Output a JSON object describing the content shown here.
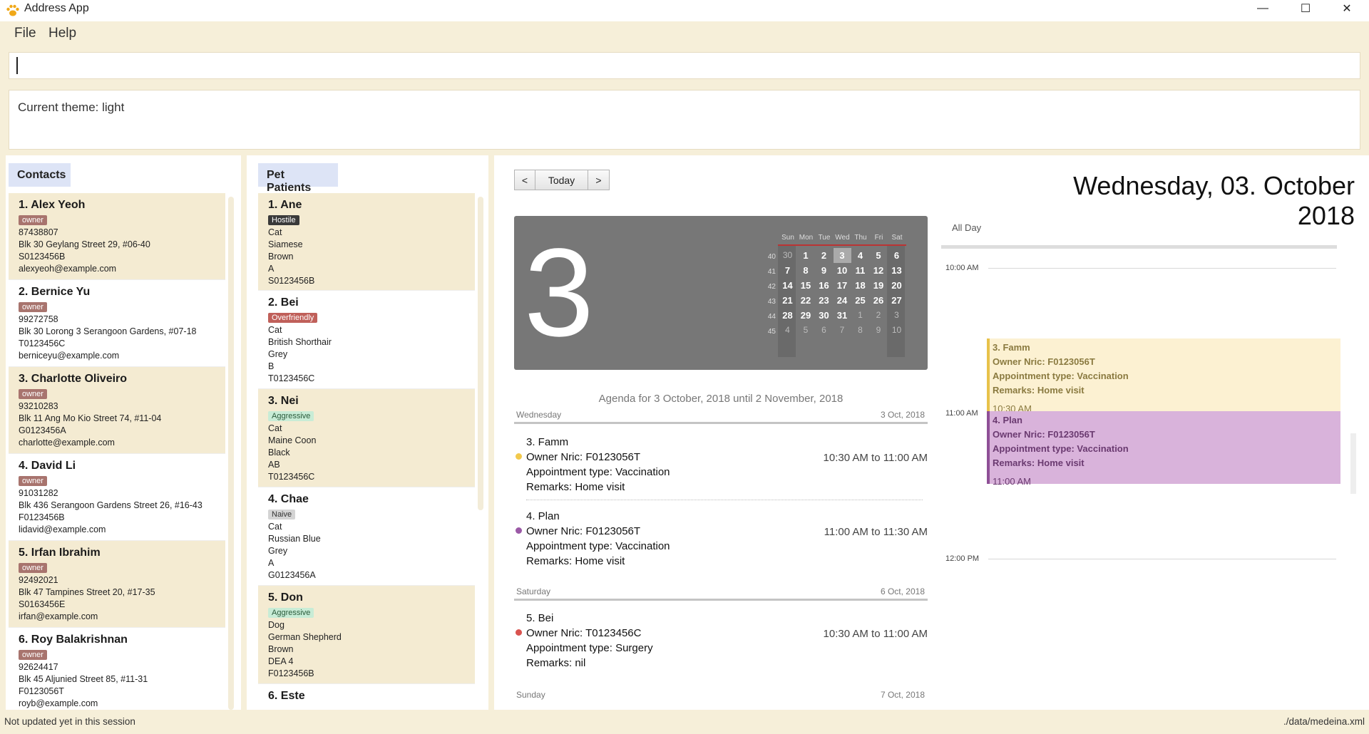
{
  "window": {
    "title": "Address App",
    "minimize": "—",
    "maximize": "☐",
    "close": "✕"
  },
  "menu": {
    "file": "File",
    "help": "Help"
  },
  "command": {
    "value": ""
  },
  "result": {
    "text": "Current theme: light"
  },
  "contacts": {
    "header": "Contacts",
    "items": [
      {
        "index": "1.",
        "name": "Alex Yeoh",
        "tag": "owner",
        "phone": "87438807",
        "address": "Blk 30 Geylang Street 29, #06-40",
        "nric": "S0123456B",
        "email": "alexyeoh@example.com"
      },
      {
        "index": "2.",
        "name": "Bernice Yu",
        "tag": "owner",
        "phone": "99272758",
        "address": "Blk 30 Lorong 3 Serangoon Gardens, #07-18",
        "nric": "T0123456C",
        "email": "berniceyu@example.com"
      },
      {
        "index": "3.",
        "name": "Charlotte Oliveiro",
        "tag": "owner",
        "phone": "93210283",
        "address": "Blk 11 Ang Mo Kio Street 74, #11-04",
        "nric": "G0123456A",
        "email": "charlotte@example.com"
      },
      {
        "index": "4.",
        "name": "David Li",
        "tag": "owner",
        "phone": "91031282",
        "address": "Blk 436 Serangoon Gardens Street 26, #16-43",
        "nric": "F0123456B",
        "email": "lidavid@example.com"
      },
      {
        "index": "5.",
        "name": "Irfan Ibrahim",
        "tag": "owner",
        "phone": "92492021",
        "address": "Blk 47 Tampines Street 20, #17-35",
        "nric": "S0163456E",
        "email": "irfan@example.com"
      },
      {
        "index": "6.",
        "name": "Roy Balakrishnan",
        "tag": "owner",
        "phone": "92624417",
        "address": "Blk 45 Aljunied Street 85, #11-31",
        "nric": "F0123056T",
        "email": "royb@example.com"
      }
    ]
  },
  "pets": {
    "header": "Pet Patients",
    "items": [
      {
        "index": "1.",
        "name": "Ane",
        "tag": "Hostile",
        "tag_color": "#3a3a3a",
        "tag_text": "#ffffff",
        "species": "Cat",
        "breed": "Siamese",
        "colour": "Brown",
        "blood": "A",
        "owner": "S0123456B"
      },
      {
        "index": "2.",
        "name": "Bei",
        "tag": "Overfriendly",
        "tag_color": "#c0605a",
        "tag_text": "#ffffff",
        "species": "Cat",
        "breed": "British Shorthair",
        "colour": "Grey",
        "blood": "B",
        "owner": "T0123456C"
      },
      {
        "index": "3.",
        "name": "Nei",
        "tag": "Aggressive",
        "tag_color": "#c8ecd6",
        "tag_text": "#2a5a3a",
        "species": "Cat",
        "breed": "Maine Coon",
        "colour": "Black",
        "blood": "AB",
        "owner": "T0123456C"
      },
      {
        "index": "4.",
        "name": "Chae",
        "tag": "Naive",
        "tag_color": "#d4d4d4",
        "tag_text": "#333333",
        "species": "Cat",
        "breed": "Russian Blue",
        "colour": "Grey",
        "blood": "A",
        "owner": "G0123456A"
      },
      {
        "index": "5.",
        "name": "Don",
        "tag": "Aggressive",
        "tag_color": "#c8ecd6",
        "tag_text": "#2a5a3a",
        "species": "Dog",
        "breed": "German Shepherd",
        "colour": "Brown",
        "blood": "DEA 4",
        "owner": "F0123456B"
      },
      {
        "index": "6.",
        "name": "Este",
        "tag": "",
        "tag_color": "",
        "tag_text": "",
        "species": "",
        "breed": "",
        "colour": "",
        "blood": "",
        "owner": ""
      }
    ]
  },
  "calendar": {
    "prev": "<",
    "today": "Today",
    "next": ">",
    "date_heading": "Wednesday, 03. October 2018",
    "big_day": "3",
    "weekdays": [
      "Sun",
      "Mon",
      "Tue",
      "Wed",
      "Thu",
      "Fri",
      "Sat"
    ],
    "weeks": [
      {
        "wk": "40",
        "days": [
          "30",
          "1",
          "2",
          "3",
          "4",
          "5",
          "6"
        ]
      },
      {
        "wk": "41",
        "days": [
          "7",
          "8",
          "9",
          "10",
          "11",
          "12",
          "13"
        ]
      },
      {
        "wk": "42",
        "days": [
          "14",
          "15",
          "16",
          "17",
          "18",
          "19",
          "20"
        ]
      },
      {
        "wk": "43",
        "days": [
          "21",
          "22",
          "23",
          "24",
          "25",
          "26",
          "27"
        ]
      },
      {
        "wk": "44",
        "days": [
          "28",
          "29",
          "30",
          "31",
          "1",
          "2",
          "3"
        ]
      },
      {
        "wk": "45",
        "days": [
          "4",
          "5",
          "6",
          "7",
          "8",
          "9",
          "10"
        ]
      }
    ],
    "agenda_title": "Agenda for 3 October, 2018 until 2 November, 2018",
    "day_heads": [
      {
        "name": "Wednesday",
        "date": "3 Oct, 2018"
      },
      {
        "name": "Saturday",
        "date": "6 Oct, 2018"
      },
      {
        "name": "Sunday",
        "date": "7 Oct, 2018"
      }
    ],
    "entries": [
      {
        "title": "3. Famm",
        "owner": "Owner Nric: F0123056T",
        "type": "Appointment type: Vaccination",
        "remarks": "Remarks: Home visit",
        "time": "10:30 AM to 11:00 AM",
        "color": "#f2c94c"
      },
      {
        "title": "4. Plan",
        "owner": "Owner Nric: F0123056T",
        "type": "Appointment type: Vaccination",
        "remarks": "Remarks: Home visit",
        "time": "11:00 AM to 11:30 AM",
        "color": "#9b59a6"
      },
      {
        "title": "5. Bei",
        "owner": "Owner Nric: T0123456C",
        "type": "Appointment type: Surgery",
        "remarks": "Remarks: nil",
        "time": "10:30 AM to 11:00 AM",
        "color": "#d9534f"
      }
    ],
    "day_view": {
      "all_day": "All Day",
      "hours": [
        "10:00 AM",
        "11:00 AM",
        "12:00 PM"
      ],
      "events": [
        {
          "title": "3. Famm",
          "owner": "Owner Nric: F0123056T",
          "type": "Appointment type: Vaccination",
          "remarks": "Remarks: Home visit",
          "time": "10:30 AM",
          "bg": "#fcf1d2",
          "border": "#e8c24a",
          "text": "#8a7a40"
        },
        {
          "title": "4. Plan",
          "owner": "Owner Nric: F0123056T",
          "type": "Appointment type: Vaccination",
          "remarks": "Remarks: Home visit",
          "time": "11:00 AM",
          "bg": "#d9b3db",
          "border": "#8e4f96",
          "text": "#6a3a70"
        }
      ]
    }
  },
  "status": {
    "left": "Not updated yet in this session",
    "right": "./data/medeina.xml"
  }
}
